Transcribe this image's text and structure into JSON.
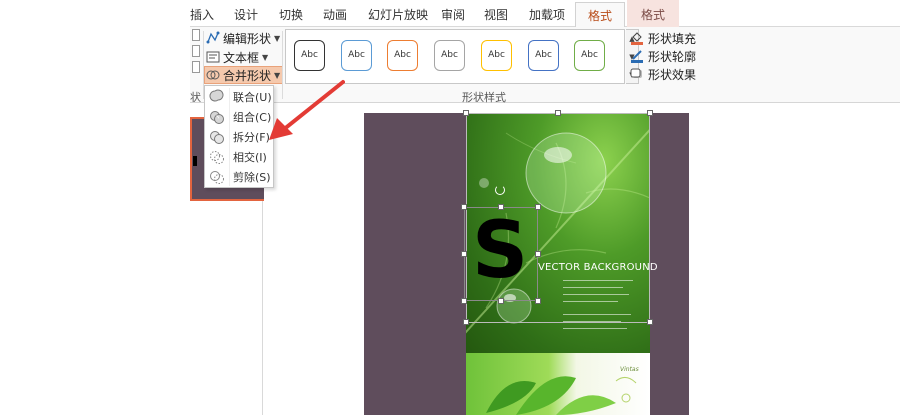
{
  "ribbon": {
    "tabs": [
      "插入",
      "设计",
      "切换",
      "动画",
      "幻灯片放映",
      "审阅",
      "视图",
      "加载项",
      "格式",
      "格式"
    ],
    "active_tab": "格式",
    "insert_shapes_group_label": "状",
    "drawing_commands": {
      "edit_shape": "编辑形状",
      "text_box": "文本框",
      "merge_shapes": "合并形状"
    },
    "shape_styles": {
      "group_label": "形状样式",
      "swatch_label": "Abc",
      "swatch_colors": [
        "#333333",
        "#5b9bd5",
        "#ed7d31",
        "#a5a5a5",
        "#ffc000",
        "#4472c4",
        "#70ad47"
      ]
    },
    "format_commands": {
      "shape_fill": "形状填充",
      "shape_outline": "形状轮廓",
      "shape_effects": "形状效果"
    }
  },
  "merge_menu": {
    "items": [
      {
        "label": "联合(U)",
        "icon": "union-icon"
      },
      {
        "label": "组合(C)",
        "icon": "combine-icon"
      },
      {
        "label": "拆分(F)",
        "icon": "fragment-icon"
      },
      {
        "label": "相交(I)",
        "icon": "intersect-icon"
      },
      {
        "label": "剪除(S)",
        "icon": "subtract-icon"
      }
    ]
  },
  "slide": {
    "background_color": "#5f4d5c",
    "letter": "S",
    "poster_title": "VECTOR BACKGROUND",
    "bottom_caption": "Vintas"
  },
  "annotation": {
    "arrow_color": "#e33b35"
  }
}
